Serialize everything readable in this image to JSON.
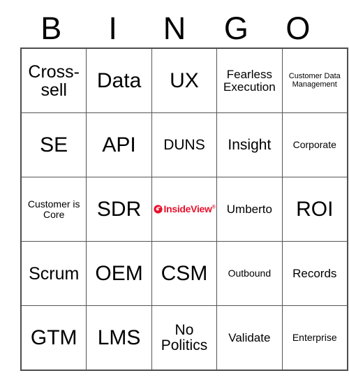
{
  "card": {
    "title": "BINGO",
    "header_letters": [
      "B",
      "I",
      "N",
      "G",
      "O"
    ],
    "free_space": {
      "position": "row3-col3",
      "logo_name": "InsideView",
      "logo_text": "InsideView",
      "logo_trademark": "®",
      "logo_color": "#e8112d"
    },
    "colors": {
      "background": "#ffffff",
      "text": "#000000",
      "grid_line": "#555555",
      "grid_border": "#4d4d4d",
      "brand_red": "#e8112d"
    },
    "rows": [
      [
        {
          "label": "Cross-sell",
          "size": "lg"
        },
        {
          "label": "Data",
          "size": "xl"
        },
        {
          "label": "UX",
          "size": "xl"
        },
        {
          "label": "Fearless Execution",
          "size": "sm"
        },
        {
          "label": "Customer Data Management",
          "size": "xxs"
        }
      ],
      [
        {
          "label": "SE",
          "size": "xl"
        },
        {
          "label": "API",
          "size": "xl"
        },
        {
          "label": "DUNS",
          "size": "md"
        },
        {
          "label": "Insight",
          "size": "md"
        },
        {
          "label": "Corporate",
          "size": "xs"
        }
      ],
      [
        {
          "label": "Customer is Core",
          "size": "xs"
        },
        {
          "label": "SDR",
          "size": "xl"
        },
        {
          "label": "",
          "size": "md"
        },
        {
          "label": "Umberto",
          "size": "sm"
        },
        {
          "label": "ROI",
          "size": "xl"
        }
      ],
      [
        {
          "label": "Scrum",
          "size": "lg"
        },
        {
          "label": "OEM",
          "size": "xl"
        },
        {
          "label": "CSM",
          "size": "xl"
        },
        {
          "label": "Outbound",
          "size": "xs"
        },
        {
          "label": "Records",
          "size": "sm"
        }
      ],
      [
        {
          "label": "GTM",
          "size": "xl"
        },
        {
          "label": "LMS",
          "size": "xl"
        },
        {
          "label": "No Politics",
          "size": "md"
        },
        {
          "label": "Validate",
          "size": "sm"
        },
        {
          "label": "Enterprise",
          "size": "xs"
        }
      ]
    ]
  }
}
